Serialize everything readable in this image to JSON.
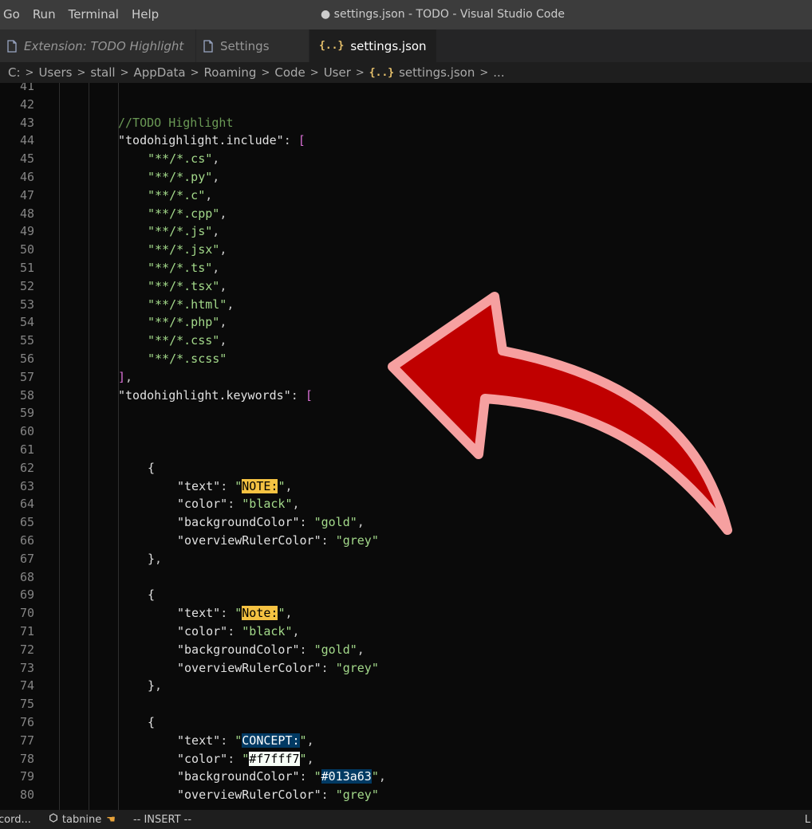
{
  "menu": [
    "Go",
    "Run",
    "Terminal",
    "Help"
  ],
  "window_title": "● settings.json - TODO - Visual Studio Code",
  "tabs": [
    {
      "label": "Extension: TODO Highlight",
      "icon": "file-icon",
      "italic": true,
      "active": false
    },
    {
      "label": "Settings",
      "icon": "file-icon",
      "italic": false,
      "active": false
    },
    {
      "label": "settings.json",
      "icon": "json-braces-icon",
      "italic": false,
      "active": true,
      "dirty": true
    }
  ],
  "breadcrumb": {
    "segments": [
      "C:",
      "Users",
      "stall",
      "AppData",
      "Roaming",
      "Code",
      "User"
    ],
    "file": "settings.json",
    "trailing": "..."
  },
  "editor": {
    "lines": [
      {
        "n": "41",
        "indent": 0,
        "tokens": []
      },
      {
        "n": "42",
        "indent": 0,
        "tokens": []
      },
      {
        "n": "43",
        "indent": 2,
        "tokens": [
          {
            "t": "//TODO Highlight",
            "c": "c"
          }
        ]
      },
      {
        "n": "44",
        "indent": 2,
        "tokens": [
          {
            "t": "\"todohighlight.include\"",
            "c": "key"
          },
          {
            "t": ": ",
            "c": "p"
          },
          {
            "t": "[",
            "c": "br"
          }
        ]
      },
      {
        "n": "45",
        "indent": 3,
        "tokens": [
          {
            "t": "\"**/*.cs\"",
            "c": "s"
          },
          {
            "t": ",",
            "c": "p"
          }
        ]
      },
      {
        "n": "46",
        "indent": 3,
        "tokens": [
          {
            "t": "\"**/*.py\"",
            "c": "s"
          },
          {
            "t": ",",
            "c": "p"
          }
        ]
      },
      {
        "n": "47",
        "indent": 3,
        "tokens": [
          {
            "t": "\"**/*.c\"",
            "c": "s"
          },
          {
            "t": ",",
            "c": "p"
          }
        ]
      },
      {
        "n": "48",
        "indent": 3,
        "tokens": [
          {
            "t": "\"**/*.cpp\"",
            "c": "s"
          },
          {
            "t": ",",
            "c": "p"
          }
        ]
      },
      {
        "n": "49",
        "indent": 3,
        "tokens": [
          {
            "t": "\"**/*.js\"",
            "c": "s"
          },
          {
            "t": ",",
            "c": "p"
          }
        ]
      },
      {
        "n": "50",
        "indent": 3,
        "tokens": [
          {
            "t": "\"**/*.jsx\"",
            "c": "s"
          },
          {
            "t": ",",
            "c": "p"
          }
        ]
      },
      {
        "n": "51",
        "indent": 3,
        "tokens": [
          {
            "t": "\"**/*.ts\"",
            "c": "s"
          },
          {
            "t": ",",
            "c": "p"
          }
        ]
      },
      {
        "n": "52",
        "indent": 3,
        "tokens": [
          {
            "t": "\"**/*.tsx\"",
            "c": "s"
          },
          {
            "t": ",",
            "c": "p"
          }
        ]
      },
      {
        "n": "53",
        "indent": 3,
        "tokens": [
          {
            "t": "\"**/*.html\"",
            "c": "s"
          },
          {
            "t": ",",
            "c": "p"
          }
        ]
      },
      {
        "n": "54",
        "indent": 3,
        "tokens": [
          {
            "t": "\"**/*.php\"",
            "c": "s"
          },
          {
            "t": ",",
            "c": "p"
          }
        ]
      },
      {
        "n": "55",
        "indent": 3,
        "tokens": [
          {
            "t": "\"**/*.css\"",
            "c": "s"
          },
          {
            "t": ",",
            "c": "p"
          }
        ]
      },
      {
        "n": "56",
        "indent": 3,
        "tokens": [
          {
            "t": "\"**/*.scss\"",
            "c": "s"
          }
        ]
      },
      {
        "n": "57",
        "indent": 2,
        "tokens": [
          {
            "t": "]",
            "c": "br"
          },
          {
            "t": ",",
            "c": "p"
          }
        ]
      },
      {
        "n": "58",
        "indent": 2,
        "tokens": [
          {
            "t": "\"todohighlight.keywords\"",
            "c": "key"
          },
          {
            "t": ": ",
            "c": "p"
          },
          {
            "t": "[",
            "c": "br"
          }
        ]
      },
      {
        "n": "59",
        "indent": 0,
        "tokens": []
      },
      {
        "n": "60",
        "indent": 0,
        "tokens": []
      },
      {
        "n": "61",
        "indent": 0,
        "tokens": []
      },
      {
        "n": "62",
        "indent": 3,
        "tokens": [
          {
            "t": "{",
            "c": "br2"
          }
        ]
      },
      {
        "n": "63",
        "indent": 4,
        "tokens": [
          {
            "t": "\"text\"",
            "c": "key"
          },
          {
            "t": ": ",
            "c": "p"
          },
          {
            "t": "\"",
            "c": "s"
          },
          {
            "t": "NOTE:",
            "c": "hl-gold"
          },
          {
            "t": "\"",
            "c": "s"
          },
          {
            "t": ",",
            "c": "p"
          }
        ]
      },
      {
        "n": "64",
        "indent": 4,
        "tokens": [
          {
            "t": "\"color\"",
            "c": "key"
          },
          {
            "t": ": ",
            "c": "p"
          },
          {
            "t": "\"black\"",
            "c": "s"
          },
          {
            "t": ",",
            "c": "p"
          }
        ]
      },
      {
        "n": "65",
        "indent": 4,
        "tokens": [
          {
            "t": "\"backgroundColor\"",
            "c": "key"
          },
          {
            "t": ": ",
            "c": "p"
          },
          {
            "t": "\"gold\"",
            "c": "s"
          },
          {
            "t": ",",
            "c": "p"
          }
        ]
      },
      {
        "n": "66",
        "indent": 4,
        "tokens": [
          {
            "t": "\"overviewRulerColor\"",
            "c": "key"
          },
          {
            "t": ": ",
            "c": "p"
          },
          {
            "t": "\"grey\"",
            "c": "s"
          }
        ]
      },
      {
        "n": "67",
        "indent": 3,
        "tokens": [
          {
            "t": "}",
            "c": "br2"
          },
          {
            "t": ",",
            "c": "p"
          }
        ]
      },
      {
        "n": "68",
        "indent": 0,
        "tokens": []
      },
      {
        "n": "69",
        "indent": 3,
        "tokens": [
          {
            "t": "{",
            "c": "br2"
          }
        ]
      },
      {
        "n": "70",
        "indent": 4,
        "tokens": [
          {
            "t": "\"text\"",
            "c": "key"
          },
          {
            "t": ": ",
            "c": "p"
          },
          {
            "t": "\"",
            "c": "s"
          },
          {
            "t": "Note:",
            "c": "hl-gold"
          },
          {
            "t": "\"",
            "c": "s"
          },
          {
            "t": ",",
            "c": "p"
          }
        ]
      },
      {
        "n": "71",
        "indent": 4,
        "tokens": [
          {
            "t": "\"color\"",
            "c": "key"
          },
          {
            "t": ": ",
            "c": "p"
          },
          {
            "t": "\"black\"",
            "c": "s"
          },
          {
            "t": ",",
            "c": "p"
          }
        ]
      },
      {
        "n": "72",
        "indent": 4,
        "tokens": [
          {
            "t": "\"backgroundColor\"",
            "c": "key"
          },
          {
            "t": ": ",
            "c": "p"
          },
          {
            "t": "\"gold\"",
            "c": "s"
          },
          {
            "t": ",",
            "c": "p"
          }
        ]
      },
      {
        "n": "73",
        "indent": 4,
        "tokens": [
          {
            "t": "\"overviewRulerColor\"",
            "c": "key"
          },
          {
            "t": ": ",
            "c": "p"
          },
          {
            "t": "\"grey\"",
            "c": "s"
          }
        ]
      },
      {
        "n": "74",
        "indent": 3,
        "tokens": [
          {
            "t": "}",
            "c": "br2"
          },
          {
            "t": ",",
            "c": "p"
          }
        ]
      },
      {
        "n": "75",
        "indent": 0,
        "tokens": []
      },
      {
        "n": "76",
        "indent": 3,
        "tokens": [
          {
            "t": "{",
            "c": "br2"
          }
        ]
      },
      {
        "n": "77",
        "indent": 4,
        "tokens": [
          {
            "t": "\"text\"",
            "c": "key"
          },
          {
            "t": ": ",
            "c": "p"
          },
          {
            "t": "\"",
            "c": "s"
          },
          {
            "t": "CONCEPT:",
            "c": "hl-navy"
          },
          {
            "t": "\"",
            "c": "s"
          },
          {
            "t": ",",
            "c": "p"
          }
        ]
      },
      {
        "n": "78",
        "indent": 4,
        "tokens": [
          {
            "t": "\"color\"",
            "c": "key"
          },
          {
            "t": ": ",
            "c": "p"
          },
          {
            "t": "\"",
            "c": "s"
          },
          {
            "t": "#f7fff7",
            "c": "hl-white"
          },
          {
            "t": "\"",
            "c": "s"
          },
          {
            "t": ",",
            "c": "p"
          }
        ]
      },
      {
        "n": "79",
        "indent": 4,
        "tokens": [
          {
            "t": "\"backgroundColor\"",
            "c": "key"
          },
          {
            "t": ": ",
            "c": "p"
          },
          {
            "t": "\"",
            "c": "s"
          },
          {
            "t": "#013a63",
            "c": "hl-navy"
          },
          {
            "t": "\"",
            "c": "s"
          },
          {
            "t": ",",
            "c": "p"
          }
        ]
      },
      {
        "n": "80",
        "indent": 4,
        "tokens": [
          {
            "t": "\"overviewRulerColor\"",
            "c": "key"
          },
          {
            "t": ": ",
            "c": "p"
          },
          {
            "t": "\"grey\"",
            "c": "s"
          }
        ]
      }
    ]
  },
  "statusbar": {
    "left": "cord...",
    "tabnine": "tabnine",
    "mode": "-- INSERT --",
    "right": "L"
  },
  "colors": {
    "arrow_fill": "#c00000",
    "arrow_stroke": "#f6a0a0",
    "gold": "#f5c242",
    "navy": "#013a63"
  }
}
